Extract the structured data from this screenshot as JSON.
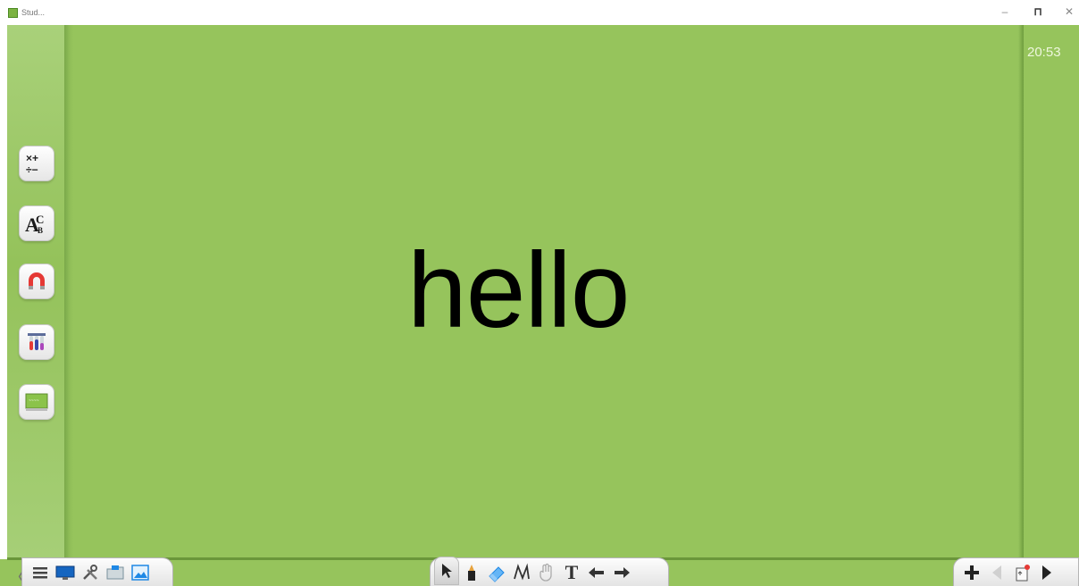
{
  "window": {
    "title": "Stud...",
    "controls": [
      "minimize",
      "maximize",
      "close"
    ],
    "minimize_glyph": "–",
    "maximize_glyph": "⊓",
    "close_glyph": "✕"
  },
  "canvas": {
    "background": "#96c45c",
    "main_text": "hello",
    "clock": "20:53"
  },
  "left_tools": [
    {
      "name": "math-tool",
      "glyph": "×+\n÷−"
    },
    {
      "name": "abc-tool",
      "glyph": "AC"
    },
    {
      "name": "magnet-tool",
      "icon": "magnet-icon"
    },
    {
      "name": "chemistry-tool",
      "icon": "test-tubes-icon"
    },
    {
      "name": "board-tool",
      "icon": "board-icon"
    }
  ],
  "bottom_left_toolbar": {
    "collapse_glyph": "〈",
    "items": [
      "menu-icon",
      "display-icon",
      "tools-icon",
      "folder-icon",
      "image-icon"
    ]
  },
  "bottom_center_toolbar": {
    "items": [
      "select-icon",
      "pen-icon",
      "eraser-icon",
      "shape-icon",
      "hand-icon",
      "text-icon",
      "undo-icon",
      "redo-icon"
    ],
    "text_glyph": "T",
    "active": "select-icon"
  },
  "bottom_right_toolbar": {
    "items": [
      "add-page-icon",
      "previous-page-icon",
      "page-list-icon",
      "next-page-icon"
    ],
    "add_glyph": "+"
  }
}
